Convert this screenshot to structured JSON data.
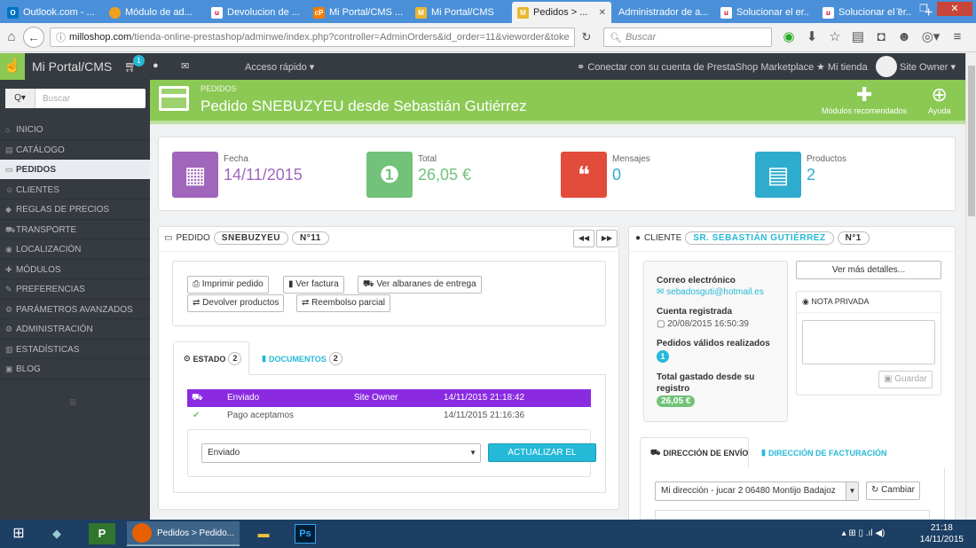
{
  "browser": {
    "tabs": [
      {
        "label": "Outlook.com - ...",
        "color": "#0072c6",
        "glyph": "O"
      },
      {
        "label": "Módulo de ad...",
        "color": "#f0a020",
        "glyph": "●"
      },
      {
        "label": "Devolucion de ...",
        "color": "#d0021b",
        "glyph": "u"
      },
      {
        "label": "Mi Portal/CMS ...",
        "color": "#f57c00",
        "glyph": "cP"
      },
      {
        "label": "Mi Portal/CMS",
        "color": "#e8b730",
        "glyph": "M"
      },
      {
        "label": "Pedidos > ...",
        "color": "#e8b730",
        "glyph": "M",
        "active": true
      },
      {
        "label": "Administrador de a...",
        "color": "#4a90d9",
        "glyph": ""
      },
      {
        "label": "Solucionar el er...",
        "color": "#d0021b",
        "glyph": "u"
      },
      {
        "label": "Solucionar el er...",
        "color": "#d0021b",
        "glyph": "u"
      }
    ],
    "new_tab": "+",
    "close_tab": "✕",
    "url_domain": "milloshop.com",
    "url_path": "/tienda-online-prestashop/adminwe/index.php?controller=AdminOrders&id_order=11&vieworder&token=",
    "search_placeholder": "Buscar",
    "win_min": "–",
    "win_max": "❐",
    "win_close": "✕"
  },
  "header": {
    "brand": "Mi Portal/CMS",
    "cart_badge": "1",
    "quick_access": "Acceso rápido ▾",
    "marketplace": "Conectar con su cuenta de PrestaShop Marketplace",
    "my_store": "Mi tienda",
    "user": "Site Owner ▾"
  },
  "sidebar": {
    "search_placeholder": "Buscar",
    "search_dropdown": "Q▾",
    "items": [
      {
        "label": "INICIO",
        "icon": "⌂"
      },
      {
        "label": "CATÁLOGO",
        "icon": "▤"
      },
      {
        "label": "PEDIDOS",
        "icon": "▭",
        "active": true
      },
      {
        "label": "CLIENTES",
        "icon": "☺"
      },
      {
        "label": "REGLAS DE PRECIOS",
        "icon": "◆"
      },
      {
        "label": "TRANSPORTE",
        "icon": "⛟"
      },
      {
        "label": "LOCALIZACIÓN",
        "icon": "◉"
      },
      {
        "label": "MÓDULOS",
        "icon": "✚"
      },
      {
        "label": "PREFERENCIAS",
        "icon": "✎"
      },
      {
        "label": "PARÁMETROS AVANZADOS",
        "icon": "⚙"
      },
      {
        "label": "ADMINISTRACIÓN",
        "icon": "⚙"
      },
      {
        "label": "ESTADÍSTICAS",
        "icon": "▥"
      },
      {
        "label": "BLOG",
        "icon": "▣"
      }
    ]
  },
  "page": {
    "breadcrumb": "PEDIDOS",
    "title": "Pedido SNEBUZYEU desde Sebastián Gutiérrez",
    "btn_modules": "Módulos recomendados",
    "btn_help": "Ayuda"
  },
  "kpis": [
    {
      "label": "Fecha",
      "value": "14/11/2015",
      "color": "#a066bb",
      "icon": "▦"
    },
    {
      "label": "Total",
      "value": "26,05 €",
      "color": "#72c279",
      "icon": "❶"
    },
    {
      "label": "Mensajes",
      "value": "0",
      "color": "#e14c3b",
      "icon": "❝"
    },
    {
      "label": "Productos",
      "value": "2",
      "color": "#2eacce",
      "icon": "▤"
    }
  ],
  "order": {
    "label": "PEDIDO",
    "reference": "SNEBUZYEU",
    "number": "N°11",
    "prev": "◀◀",
    "next": "▶▶",
    "btn_print": "Imprimir pedido",
    "btn_invoice": "Ver factura",
    "btn_delivery": "Ver albaranes de entrega",
    "btn_return": "Devolver productos",
    "btn_refund": "Reembolso parcial",
    "tab_status": "ESTADO",
    "tab_status_count": "2",
    "tab_docs": "DOCUMENTOS",
    "tab_docs_count": "2",
    "history": [
      {
        "status": "Enviado",
        "employee": "Site Owner",
        "date": "14/11/2015 21:18:42"
      },
      {
        "status": "Pago aceptamos",
        "employee": "",
        "date": "14/11/2015 21:16:36"
      }
    ],
    "status_select": "Enviado",
    "btn_update": "ACTUALIZAR EL ESTADO",
    "highlight_color": "#8a2be2"
  },
  "customer": {
    "label": "CLIENTE",
    "name": "SR. SEBASTIÁN GUTIÉRREZ",
    "number": "N°1",
    "email_label": "Correo electrónico",
    "email": "sebadosguti@hotmail.es",
    "registered_label": "Cuenta registrada",
    "registered": "20/08/2015 16:50:39",
    "valid_orders_label": "Pedidos válidos realizados",
    "valid_orders": "1",
    "spent_label": "Total gastado desde su registro",
    "spent": "26,05 €",
    "btn_details": "Ver más detalles...",
    "private_note": "NOTA PRIVADA",
    "btn_save": "Guardar",
    "tab_shipping": "DIRECCIÓN DE ENVÍO",
    "tab_billing": "DIRECCIÓN DE FACTURACIÓN",
    "address_select": "Mi dirección - jucar 2 06480 Montijo Badajoz",
    "btn_change": "Cambiar"
  },
  "taskbar": {
    "active_app": "Pedidos > Pedido...",
    "time": "21:18",
    "date": "14/11/2015"
  }
}
